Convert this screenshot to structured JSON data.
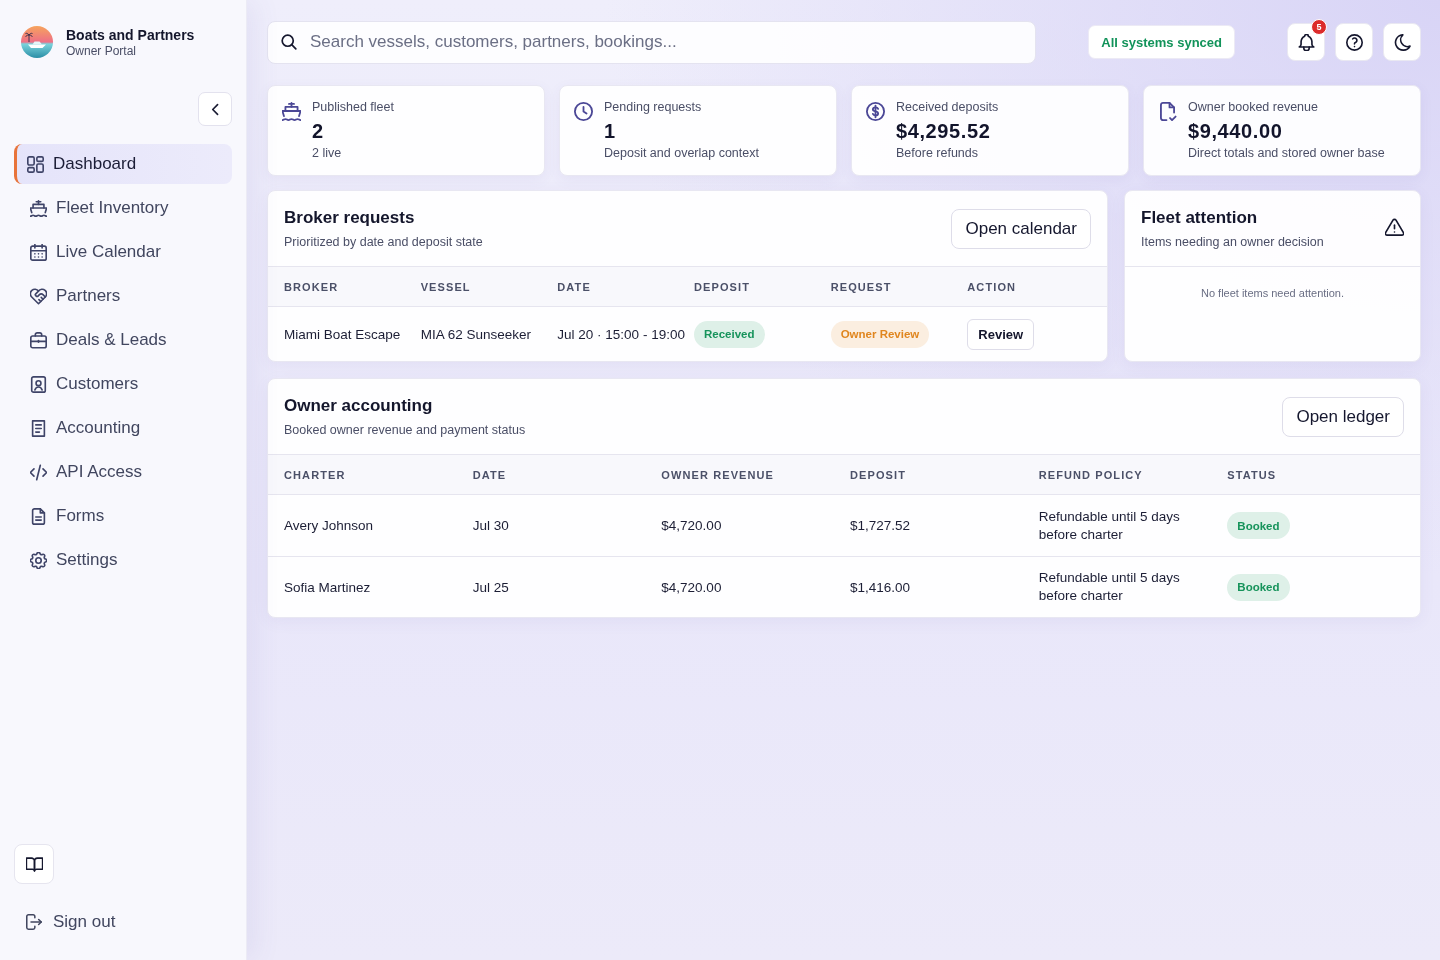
{
  "sidebar": {
    "brand": {
      "title": "Boats and Partners",
      "subtitle": "Owner Portal"
    },
    "items": [
      {
        "label": "Dashboard",
        "selected": true
      },
      {
        "label": "Fleet Inventory",
        "selected": false
      },
      {
        "label": "Live Calendar",
        "selected": false
      },
      {
        "label": "Partners",
        "selected": false
      },
      {
        "label": "Deals & Leads",
        "selected": false
      },
      {
        "label": "Customers",
        "selected": false
      },
      {
        "label": "Accounting",
        "selected": false
      },
      {
        "label": "API Access",
        "selected": false
      },
      {
        "label": "Forms",
        "selected": false
      },
      {
        "label": "Settings",
        "selected": false
      }
    ],
    "sign_out": "Sign out"
  },
  "topbar": {
    "search": {
      "placeholder": "Search vessels, customers, partners, bookings..."
    },
    "sync_status": "All systems synced",
    "notifications": "5"
  },
  "stats": [
    {
      "label": "Published fleet",
      "value": "2",
      "note": "2 live"
    },
    {
      "label": "Pending requests",
      "value": "1",
      "note": "Deposit and overlap context"
    },
    {
      "label": "Received deposits",
      "value": "$4,295.52",
      "note": "Before refunds"
    },
    {
      "label": "Owner booked revenue",
      "value": "$9,440.00",
      "note": "Direct totals and stored owner base"
    }
  ],
  "broker_requests": {
    "title": "Broker requests",
    "subtitle": "Prioritized by date and deposit state",
    "button": "Open calendar",
    "columns": [
      "BROKER",
      "VESSEL",
      "DATE",
      "DEPOSIT",
      "REQUEST",
      "ACTION"
    ],
    "rows": [
      {
        "broker": "Miami Boat Escape",
        "vessel": "MIA 62 Sunseeker",
        "date": "Jul 20 · 15:00 - 19:00",
        "deposit": {
          "label": "Received",
          "color": "#16935b"
        },
        "request": {
          "label": "Owner Review",
          "color": "#e0861f"
        },
        "action": "Review"
      }
    ]
  },
  "fleet_attention": {
    "title": "Fleet attention",
    "subtitle": "Items needing an owner decision",
    "empty": "No fleet items need attention."
  },
  "owner_accounting": {
    "title": "Owner accounting",
    "subtitle": "Booked owner revenue and payment status",
    "button": "Open ledger",
    "columns": [
      "CHARTER",
      "DATE",
      "OWNER REVENUE",
      "DEPOSIT",
      "REFUND POLICY",
      "STATUS"
    ],
    "rows": [
      {
        "charter": "Avery Johnson",
        "date": "Jul 30",
        "owner_revenue": "$4,720.00",
        "deposit": "$1,727.52",
        "refund_policy": "Refundable until 5 days before charter",
        "status": {
          "label": "Booked",
          "color": "#16935b"
        }
      },
      {
        "charter": "Sofia Martinez",
        "date": "Jul 25",
        "owner_revenue": "$4,720.00",
        "deposit": "$1,416.00",
        "refund_policy": "Refundable until 5 days before charter",
        "status": {
          "label": "Booked",
          "color": "#16935b"
        }
      }
    ]
  }
}
